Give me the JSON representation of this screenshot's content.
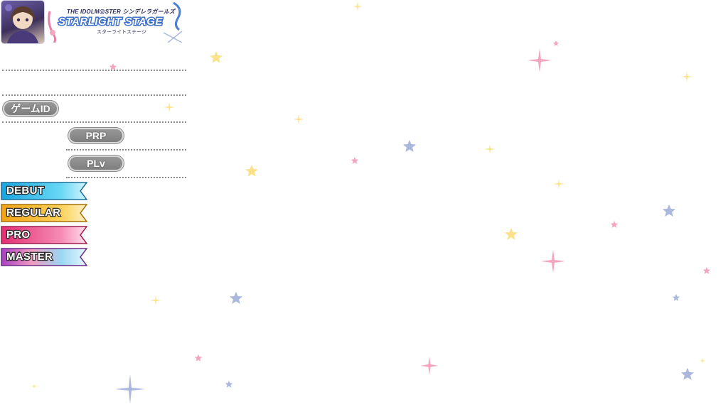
{
  "header": {
    "avatar_icon": "idol-avatar-icon",
    "logo": {
      "top_line": "THE IDOLM@STER シンデレラガールズ",
      "title": "STARLIGHT STAGE",
      "sub_line": "スターライトステージ"
    }
  },
  "profile": {
    "game_id_label": "ゲームID",
    "prp_label": "PRP",
    "plv_label": "PLv"
  },
  "difficulties": [
    {
      "label": "DEBUT",
      "color": "#2fb6e8"
    },
    {
      "label": "REGULAR",
      "color": "#f3b21c"
    },
    {
      "label": "PRO",
      "color": "#e8407f"
    },
    {
      "label": "MASTER",
      "color": "#b24fc6"
    }
  ],
  "colors": {
    "star_yellow": "#fbe28a",
    "star_pink": "#f4a6c0",
    "star_blue": "#a9b8dc"
  }
}
